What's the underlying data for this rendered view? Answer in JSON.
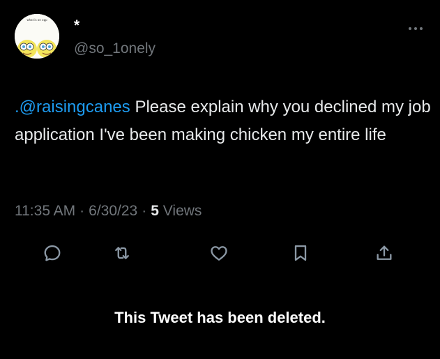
{
  "author": {
    "display_name": "*",
    "handle": "@so_1onely",
    "avatar_caption": "what is on opp"
  },
  "tweet": {
    "mention": ".@raisingcanes",
    "text": " Please explain why you declined my job application I've been making chicken my entire life"
  },
  "meta": {
    "time": "11:35 AM",
    "date": "6/30/23",
    "views_count": "5",
    "views_label": "Views"
  },
  "actions": {
    "icons": [
      "reply-icon",
      "retweet-icon",
      "like-icon",
      "bookmark-icon",
      "share-icon"
    ]
  },
  "notice": {
    "deleted": "This Tweet has been deleted."
  },
  "colors": {
    "background": "#000000",
    "accent": "#1d9bf0",
    "muted": "#71767b",
    "text": "#e7e9ea"
  }
}
